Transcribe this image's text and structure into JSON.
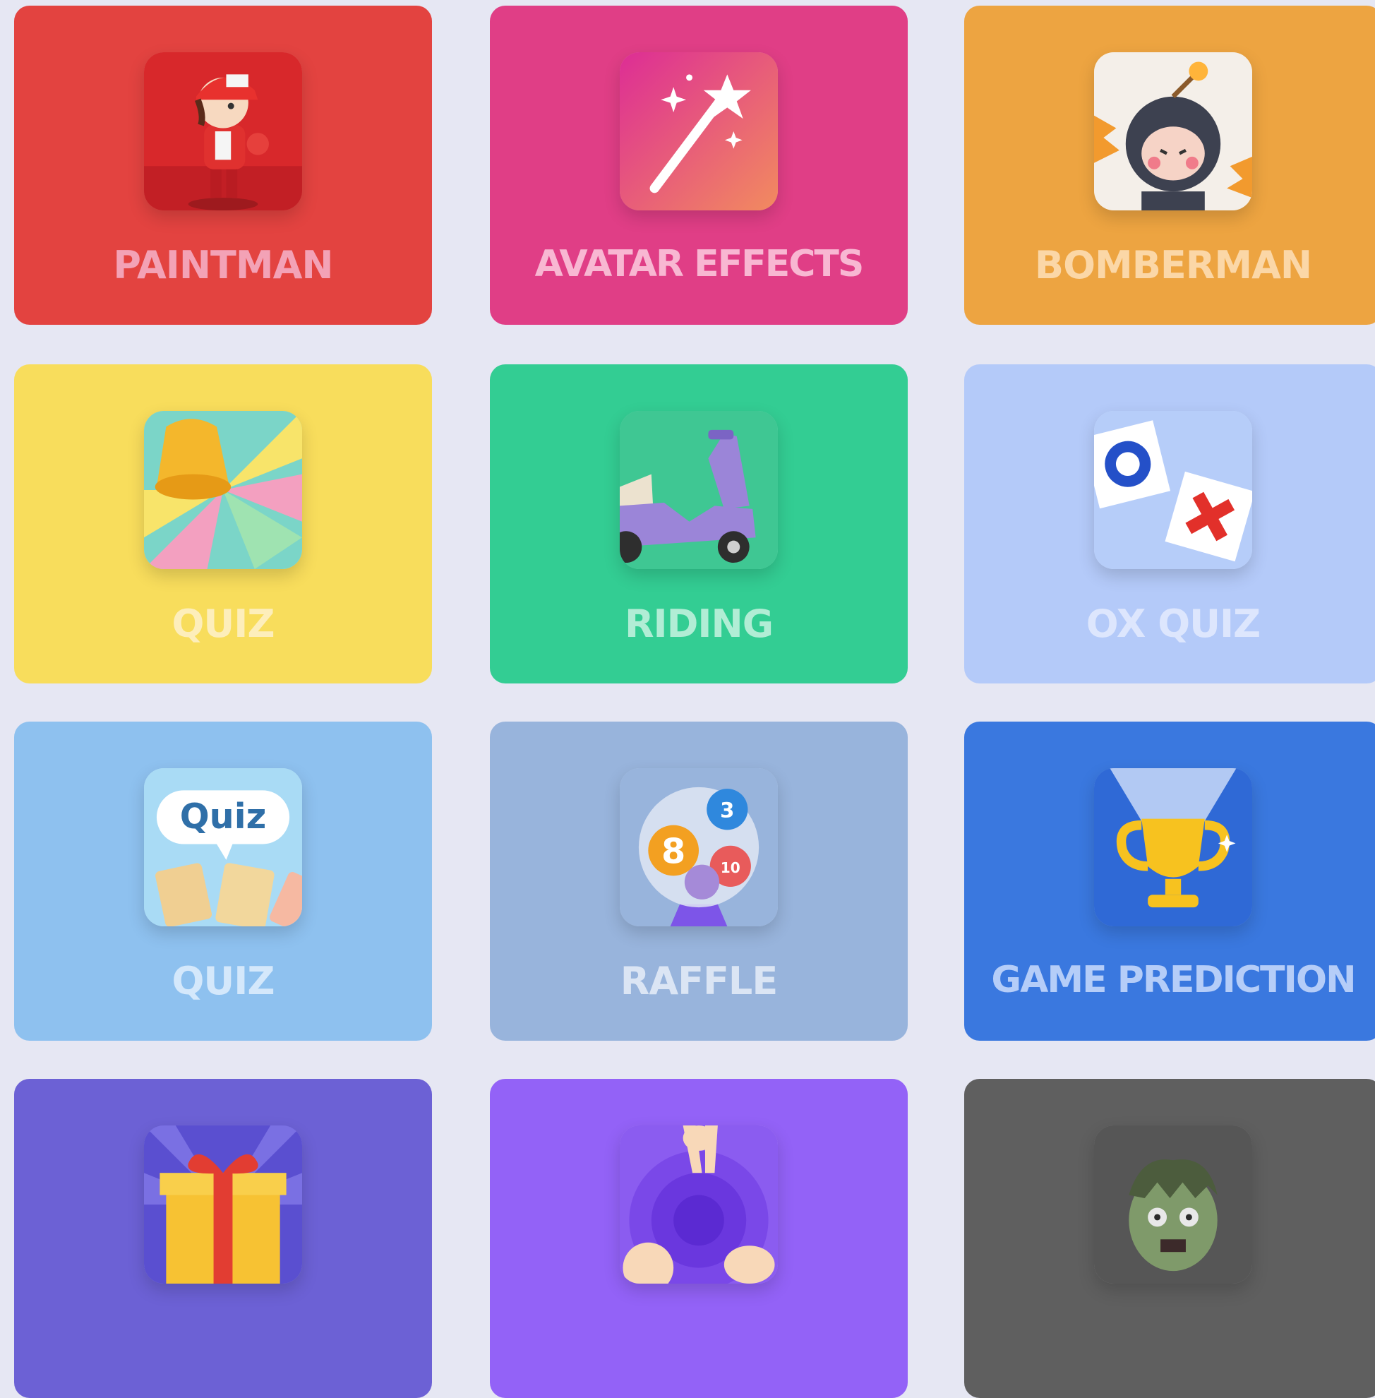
{
  "cards": [
    {
      "label": "PAINTMAN",
      "bg": "#e34340",
      "labelColor": "#f8bdd8",
      "icon": "paintman-icon"
    },
    {
      "label": "AVATAR EFFECTS",
      "bg": "#e03e86",
      "labelColor": "#ffd9e8",
      "icon": "magic-wand-icon"
    },
    {
      "label": "BOMBERMAN",
      "bg": "#eda441",
      "labelColor": "#ffe6c4",
      "icon": "bomberman-icon"
    },
    {
      "label": "QUIZ",
      "bg": "#f8dd5c",
      "labelColor": "#fff4d6",
      "icon": "quiz-bell-icon"
    },
    {
      "label": "RIDING",
      "bg": "#33cd93",
      "labelColor": "#d5f7e8",
      "icon": "scooter-icon"
    },
    {
      "label": "OX QUIZ",
      "bg": "#b4caf9",
      "labelColor": "#e9efff",
      "icon": "ox-quiz-icon"
    },
    {
      "label": "QUIZ",
      "bg": "#8ec1ef",
      "labelColor": "#e8f3ff",
      "icon": "quiz-cards-icon"
    },
    {
      "label": "RAFFLE",
      "bg": "#98b4dc",
      "labelColor": "#eef3fb",
      "icon": "raffle-balls-icon"
    },
    {
      "label": "GAME PREDICTION",
      "bg": "#3a78df",
      "labelColor": "#d8e6ff",
      "icon": "trophy-icon"
    },
    {
      "label": "",
      "bg": "#6c61d5",
      "labelColor": "#e6e3ff",
      "icon": "gift-box-icon"
    },
    {
      "label": "",
      "bg": "#9362f7",
      "labelColor": "#efe6ff",
      "icon": "rock-paper-scissors-icon"
    },
    {
      "label": "",
      "bg": "#5f5f5f",
      "labelColor": "#e5e5e5",
      "icon": "zombie-icon"
    }
  ]
}
